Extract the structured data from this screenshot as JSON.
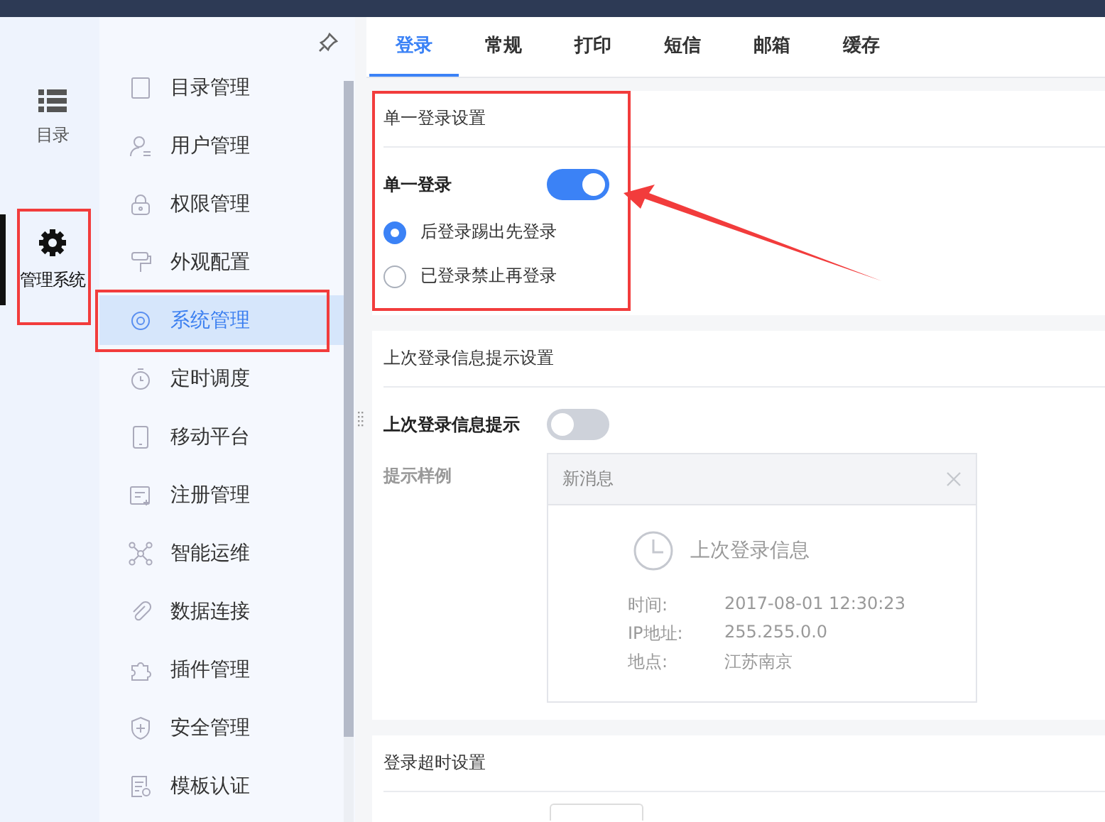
{
  "rail": {
    "items": [
      {
        "kind": "list",
        "label": "目录",
        "selected": false,
        "highlighted": false
      },
      {
        "kind": "gear",
        "label": "管理系统",
        "selected": true,
        "highlighted": true
      }
    ]
  },
  "sidebar": {
    "items": [
      {
        "kind": "table",
        "label": "目录管理",
        "selected": false,
        "highlighted": false
      },
      {
        "kind": "user",
        "label": "用户管理",
        "selected": false,
        "highlighted": false
      },
      {
        "kind": "lock",
        "label": "权限管理",
        "selected": false,
        "highlighted": false
      },
      {
        "kind": "roller",
        "label": "外观配置",
        "selected": false,
        "highlighted": false
      },
      {
        "kind": "gear",
        "label": "系统管理",
        "selected": true,
        "highlighted": true
      },
      {
        "kind": "timer",
        "label": "定时调度",
        "selected": false,
        "highlighted": false
      },
      {
        "kind": "phone",
        "label": "移动平台",
        "selected": false,
        "highlighted": false
      },
      {
        "kind": "form",
        "label": "注册管理",
        "selected": false,
        "highlighted": false
      },
      {
        "kind": "network",
        "label": "智能运维",
        "selected": false,
        "highlighted": false
      },
      {
        "kind": "clip",
        "label": "数据连接",
        "selected": false,
        "highlighted": false
      },
      {
        "kind": "puzzle",
        "label": "插件管理",
        "selected": false,
        "highlighted": false
      },
      {
        "kind": "shield",
        "label": "安全管理",
        "selected": false,
        "highlighted": false
      },
      {
        "kind": "doc",
        "label": "模板认证",
        "selected": false,
        "highlighted": false
      }
    ]
  },
  "tabs": [
    {
      "label": "登录",
      "selected": true
    },
    {
      "label": "常规",
      "selected": false
    },
    {
      "label": "打印",
      "selected": false
    },
    {
      "label": "短信",
      "selected": false
    },
    {
      "label": "邮箱",
      "selected": false
    },
    {
      "label": "缓存",
      "selected": false
    }
  ],
  "sections": [
    {
      "kind": "options",
      "title": "单一登录设置",
      "highlighted": true,
      "toggle": {
        "label": "单一登录",
        "on": true
      },
      "radios": [
        {
          "label": "后登录踢出先登录",
          "selected": true
        },
        {
          "label": "已登录禁止再登录",
          "selected": false
        }
      ]
    },
    {
      "kind": "sample",
      "title": "上次登录信息提示设置",
      "highlighted": false,
      "toggle": {
        "label": "上次登录信息提示",
        "on": false
      },
      "sample": {
        "label": "提示样例",
        "header": "新消息",
        "heading": "上次登录信息",
        "rows": [
          {
            "key": "时间:",
            "value": "2017-08-01 12:30:23"
          },
          {
            "key": "IP地址:",
            "value": "255.255.0.0"
          },
          {
            "key": "地点:",
            "value": "江苏南京"
          }
        ]
      }
    },
    {
      "kind": "field",
      "title": "登录超时设置",
      "highlighted": false
    }
  ]
}
